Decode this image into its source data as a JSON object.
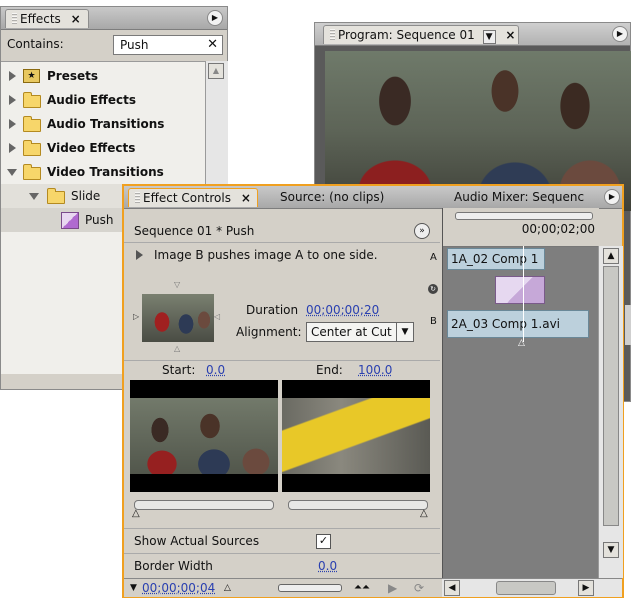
{
  "effects_panel": {
    "tab_label": "Effects",
    "close_glyph": "×",
    "menu_icon": "panel-menu-icon",
    "contains_label": "Contains:",
    "search_value": "Push",
    "clear_glyph": "✕",
    "tree": [
      {
        "label": "Presets",
        "expanded": false,
        "depth": 0
      },
      {
        "label": "Audio Effects",
        "expanded": false,
        "depth": 0
      },
      {
        "label": "Audio Transitions",
        "expanded": false,
        "depth": 0
      },
      {
        "label": "Video Effects",
        "expanded": false,
        "depth": 0
      },
      {
        "label": "Video Transitions",
        "expanded": true,
        "depth": 0
      },
      {
        "label": "Slide",
        "expanded": true,
        "depth": 1
      },
      {
        "label": "Push",
        "depth": 2,
        "selected": true
      }
    ]
  },
  "program_panel": {
    "tab_label": "Program: Sequence 01",
    "dropdown_glyph": "▼",
    "close_glyph": "×"
  },
  "effect_controls": {
    "tabs": [
      {
        "label": "Effect Controls",
        "active": true,
        "close": "×"
      },
      {
        "label": "Source: (no clips)",
        "active": false
      },
      {
        "label": "Audio Mixer: Sequenc",
        "active": false
      }
    ],
    "header_title": "Sequence 01 * Push",
    "timecode_top": "00;00;02;00",
    "description": "Image B pushes image A to one side.",
    "duration_label": "Duration",
    "duration_value": "00;00;00;20",
    "alignment_label": "Alignment:",
    "alignment_value": "Center at Cut",
    "start_label": "Start:",
    "start_value": "0.0",
    "end_label": "End:",
    "end_value": "100.0",
    "track_a_letter": "A",
    "track_b_letter": "B",
    "clip_a_label": "1A_02 Comp 1",
    "clip_b_label": "2A_03 Comp 1.avi",
    "show_sources_label": "Show Actual Sources",
    "show_sources_checked": true,
    "check_glyph": "✓",
    "border_width_label": "Border Width",
    "border_width_value": "0.0",
    "footer_timecode": "00;00;00;04"
  },
  "accent_color": "#f0a020"
}
